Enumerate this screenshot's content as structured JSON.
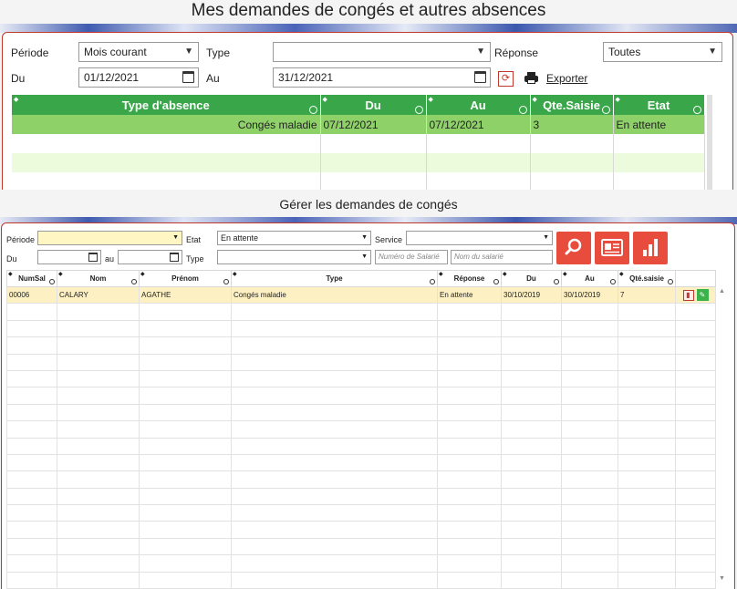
{
  "panel1": {
    "title": "Mes demandes de congés et autres absences",
    "periode_label": "Période",
    "periode_value": "Mois courant",
    "type_label": "Type",
    "type_value": "",
    "reponse_label": "Réponse",
    "reponse_value": "Toutes",
    "du_label": "Du",
    "du_value": "01/12/2021",
    "au_label": "Au",
    "au_value": "31/12/2021",
    "export_label": "Exporter",
    "columns": [
      "Type d'absence",
      "Du",
      "Au",
      "Qte.Saisie",
      "Etat"
    ],
    "rows": [
      {
        "type": "Congés maladie",
        "du": "07/12/2021",
        "au": "07/12/2021",
        "qte": "3",
        "etat": "En attente"
      }
    ]
  },
  "panel2": {
    "title": "Gérer les demandes de congés",
    "periode_label": "Période",
    "periode_value": "",
    "etat_label": "Etat",
    "etat_value": "En attente",
    "service_label": "Service",
    "service_value": "",
    "du_label": "Du",
    "au_label": "au",
    "type_label": "Type",
    "type_value": "",
    "num_placeholder": "Numéro de Salarié",
    "nom_placeholder": "Nom du salarié",
    "columns": [
      "NumSal",
      "Nom",
      "Prénom",
      "Type",
      "Réponse",
      "Du",
      "Au",
      "Qté.saisie"
    ],
    "rows": [
      {
        "numsal": "00006",
        "nom": "CALARY",
        "prenom": "AGATHE",
        "type": "Congés maladie",
        "reponse": "En attente",
        "du": "30/10/2019",
        "au": "30/10/2019",
        "qte": "7"
      }
    ]
  },
  "colors": {
    "accent_red": "#e74c3c",
    "header_green": "#3aa64a",
    "row_green": "#8fd169",
    "row_yellow": "#fdf1c4"
  }
}
